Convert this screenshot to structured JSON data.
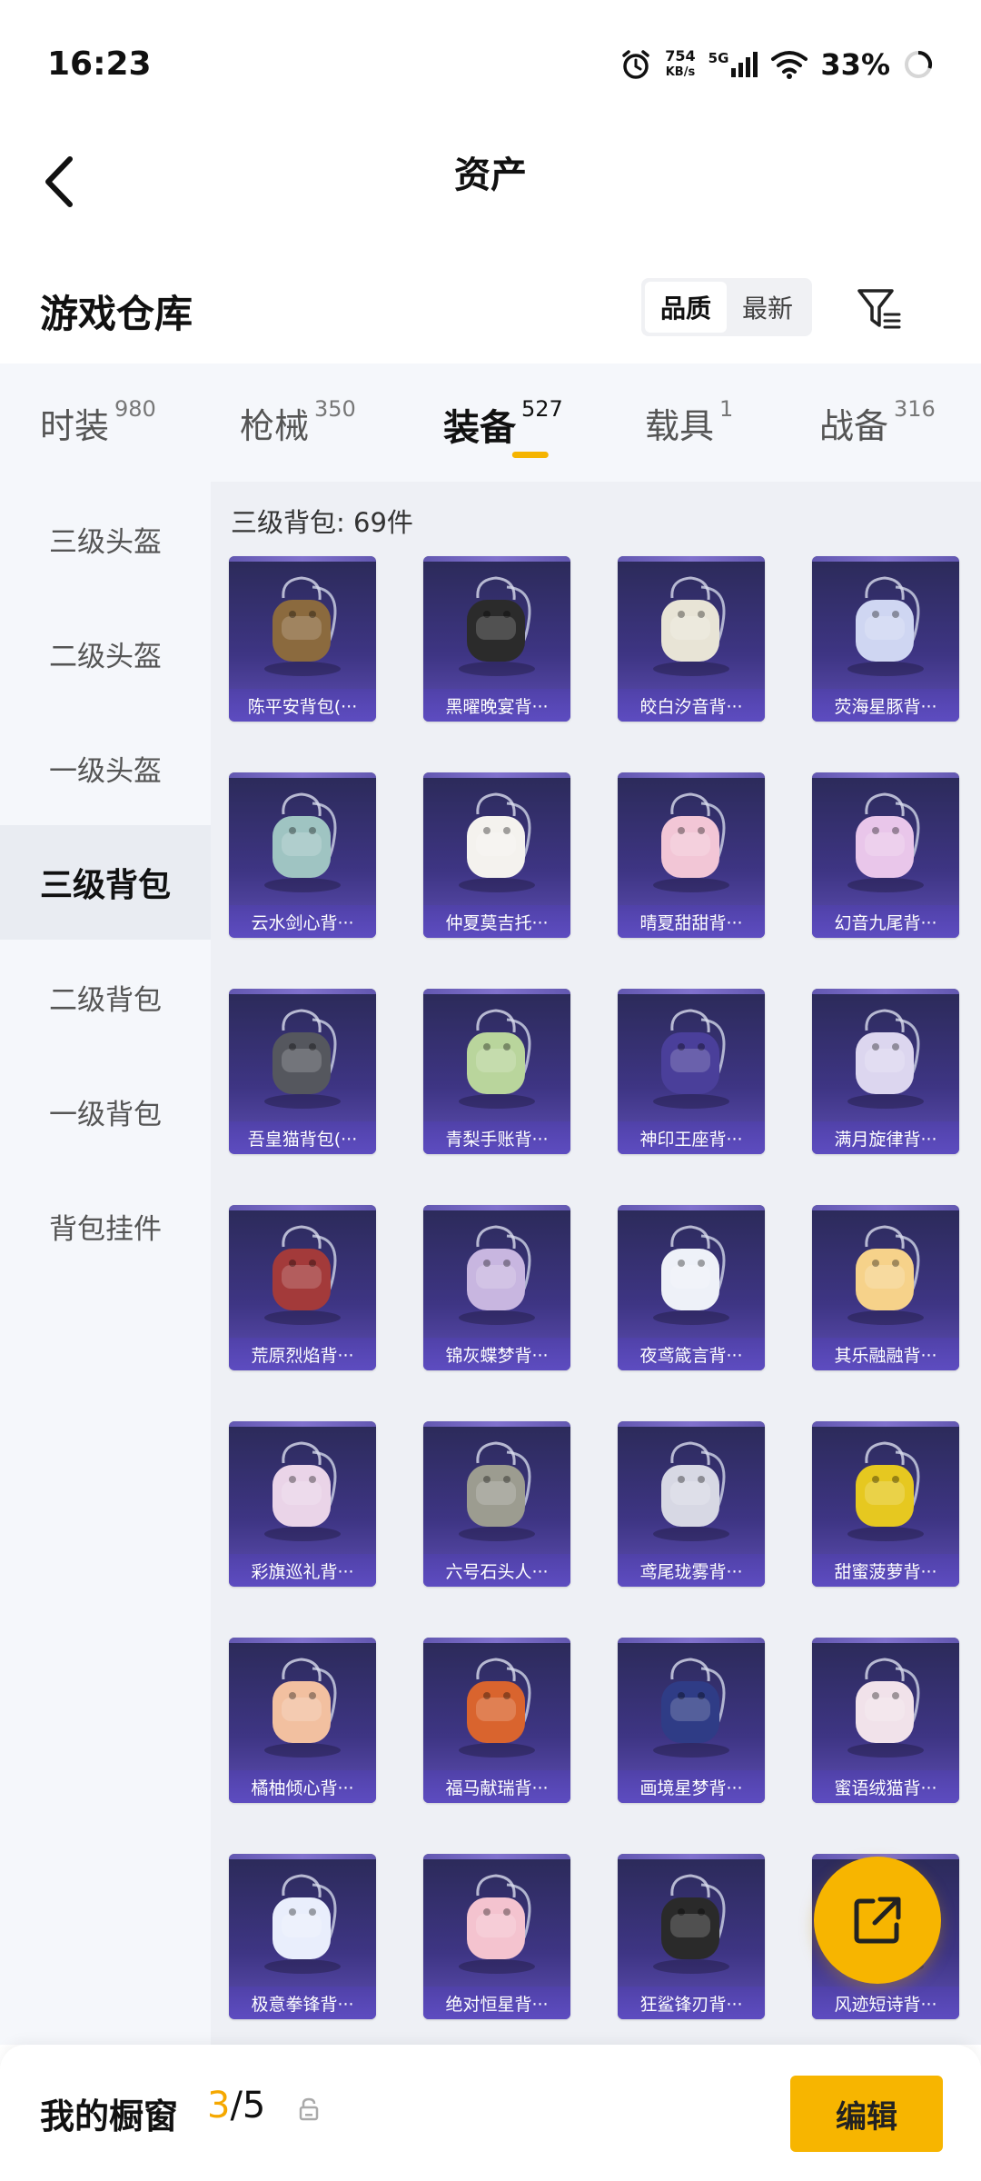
{
  "status_bar": {
    "time": "16:23",
    "net_speed_value": "754",
    "net_speed_unit": "KB/s",
    "network_gen": "5G",
    "battery_percent": "33%"
  },
  "nav": {
    "title": "资产"
  },
  "warehouse": {
    "title": "游戏仓库",
    "sort_options": [
      "品质",
      "最新"
    ],
    "active_sort": "品质"
  },
  "tabs": [
    {
      "label": "时装",
      "count": "980"
    },
    {
      "label": "枪械",
      "count": "350"
    },
    {
      "label": "装备",
      "count": "527",
      "active": true
    },
    {
      "label": "载具",
      "count": "1"
    },
    {
      "label": "战备",
      "count": "316"
    }
  ],
  "sidebar": {
    "items": [
      "三级头盔",
      "二级头盔",
      "一级头盔",
      "三级背包",
      "二级背包",
      "一级背包",
      "背包挂件"
    ],
    "active": "三级背包"
  },
  "section": {
    "title": "三级背包: 69件"
  },
  "items": [
    {
      "name": "陈平安背包(···",
      "icon": "bamboo-basket-backpack-icon"
    },
    {
      "name": "黑曜晚宴背···",
      "icon": "dog-backpack-icon"
    },
    {
      "name": "皎白汐音背···",
      "icon": "shell-backpack-icon"
    },
    {
      "name": "荧海星豚背···",
      "icon": "dolphin-backpack-icon"
    },
    {
      "name": "云水剑心背···",
      "icon": "sword-backpack-icon"
    },
    {
      "name": "仲夏莫吉托···",
      "icon": "white-bag-backpack-icon"
    },
    {
      "name": "晴夏甜甜背···",
      "icon": "pink-shell-backpack-icon"
    },
    {
      "name": "幻音九尾背···",
      "icon": "fox-tail-backpack-icon"
    },
    {
      "name": "吾皇猫背包(···",
      "icon": "cat-backpack-icon"
    },
    {
      "name": "青梨手账背···",
      "icon": "pear-backpack-icon"
    },
    {
      "name": "神印王座背···",
      "icon": "throne-backpack-icon"
    },
    {
      "name": "满月旋律背···",
      "icon": "moon-backpack-icon"
    },
    {
      "name": "荒原烈焰背···",
      "icon": "flame-backpack-icon"
    },
    {
      "name": "锦灰蝶梦背···",
      "icon": "butterfly-backpack-icon"
    },
    {
      "name": "夜鸢箴言背···",
      "icon": "flower-backpack-icon"
    },
    {
      "name": "其乐融融背···",
      "icon": "ice-cream-backpack-icon"
    },
    {
      "name": "彩旗巡礼背···",
      "icon": "flag-backpack-icon"
    },
    {
      "name": "六号石头人···",
      "icon": "stone-man-backpack-icon"
    },
    {
      "name": "鸢尾珑雾背···",
      "icon": "iris-backpack-icon"
    },
    {
      "name": "甜蜜菠萝背···",
      "icon": "pineapple-backpack-icon"
    },
    {
      "name": "橘柚倾心背···",
      "icon": "citrus-backpack-icon"
    },
    {
      "name": "福马献瑞背···",
      "icon": "horse-backpack-icon"
    },
    {
      "name": "画境星梦背···",
      "icon": "painting-backpack-icon"
    },
    {
      "name": "蜜语绒猫背···",
      "icon": "plush-cat-backpack-icon"
    },
    {
      "name": "极意拳锋背···",
      "icon": "fist-backpack-icon"
    },
    {
      "name": "绝对恒星背···",
      "icon": "popcorn-backpack-icon"
    },
    {
      "name": "狂鲨锋刃背···",
      "icon": "shark-backpack-icon"
    },
    {
      "name": "风迹短诗背···",
      "icon": "wind-backpack-icon"
    }
  ],
  "item_colors": [
    "#8b6a3e",
    "#2b2b2b",
    "#e8e4d6",
    "#cfd6f2",
    "#9fc4c2",
    "#f4f2ee",
    "#f2c6d6",
    "#e9c6ea",
    "#55575e",
    "#b9d59c",
    "#4a3f9a",
    "#dcd6ef",
    "#a33a3a",
    "#c8b6e0",
    "#eef1f8",
    "#f6d28a",
    "#ead4e8",
    "#9c9c90",
    "#d7d8e4",
    "#e6c820",
    "#f2c0a0",
    "#d9642e",
    "#2f3c86",
    "#f1e2ea",
    "#e9eefc",
    "#f4c3cf",
    "#2a2a2a",
    "#cfe4f2"
  ],
  "bottom_bar": {
    "label": "我的橱窗",
    "current": "3",
    "separator_total": "/5",
    "edit_label": "编辑"
  },
  "colors": {
    "accent": "#f7b500",
    "card_bg": "#3e3584"
  }
}
